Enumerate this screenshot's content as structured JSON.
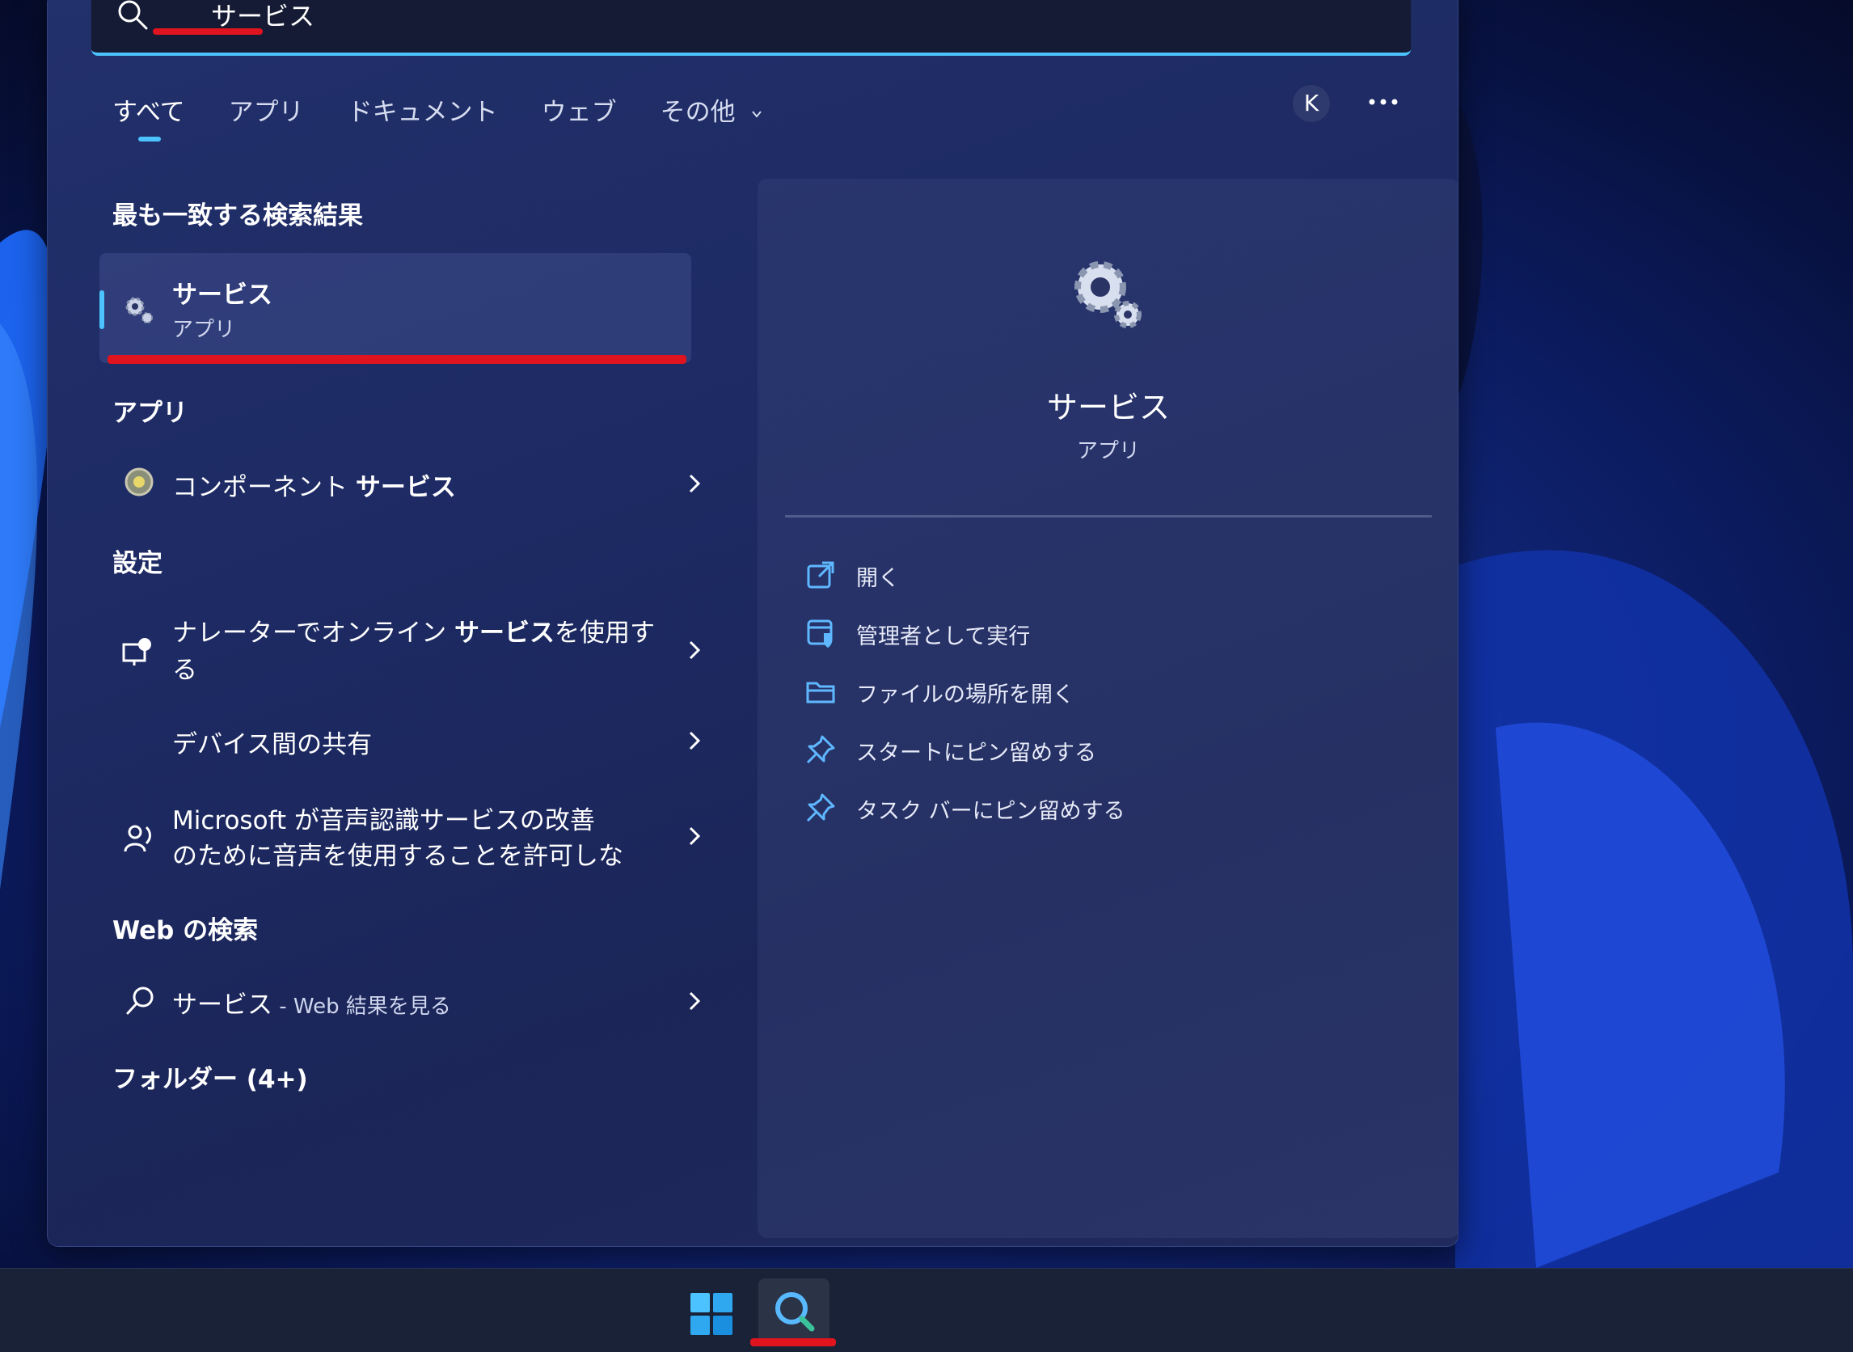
{
  "search": {
    "query": "サービス"
  },
  "tabs": [
    {
      "label": "すべて"
    },
    {
      "label": "アプリ"
    },
    {
      "label": "ドキュメント"
    },
    {
      "label": "ウェブ"
    },
    {
      "label": "その他"
    }
  ],
  "account": {
    "initial": "K"
  },
  "best_match": {
    "heading": "最も一致する検索結果",
    "title": "サービス",
    "subtitle": "アプリ"
  },
  "apps": {
    "heading": "アプリ",
    "items": [
      {
        "label_plain": "コンポーネント ",
        "label_bold": "サービス"
      }
    ]
  },
  "settings": {
    "heading": "設定",
    "items": [
      {
        "line1_plain": "ナレーターでオンライン ",
        "line1_bold": "サービス",
        "line1_rest": "を使用す",
        "line2": "る"
      },
      {
        "label": "デバイス間の共有"
      },
      {
        "line1": "Microsoft が音声認識サービスの改善",
        "line2": "のために音声を使用することを許可しな"
      }
    ]
  },
  "web": {
    "heading": "Web の検索",
    "query": "サービス",
    "suffix": " - Web 結果を見る"
  },
  "folders": {
    "heading": "フォルダー (4+)"
  },
  "detail": {
    "title": "サービス",
    "subtitle": "アプリ",
    "actions": [
      {
        "label": "開く",
        "icon": "open-external-icon"
      },
      {
        "label": "管理者として実行",
        "icon": "shield-run-icon"
      },
      {
        "label": "ファイルの場所を開く",
        "icon": "folder-icon"
      },
      {
        "label": "スタートにピン留めする",
        "icon": "pin-icon"
      },
      {
        "label": "タスク バーにピン留めする",
        "icon": "pin-icon"
      }
    ]
  },
  "colors": {
    "accent": "#4cc2ff",
    "annotation": "#e0141e"
  }
}
